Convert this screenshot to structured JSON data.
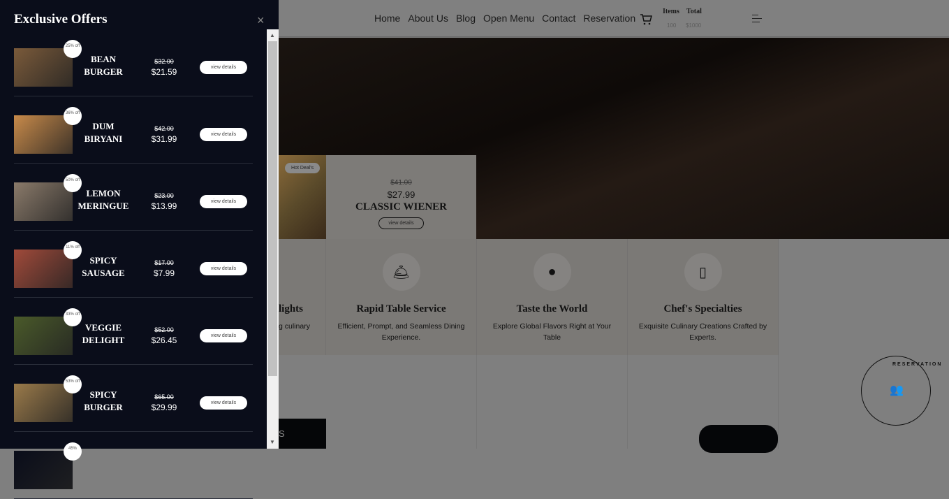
{
  "nav": {
    "items": [
      "Home",
      "About Us",
      "Blog",
      "Open Menu",
      "Contact",
      "Reservation"
    ]
  },
  "cart": {
    "items_label": "Items",
    "total_label": "Total",
    "items_value": "100",
    "total_value": "$1000"
  },
  "hero_deal": {
    "badge": "Hot Deal's",
    "old_price": "$41.00",
    "price": "$27.99",
    "name": "CLASSIC WIENER",
    "button": "view details"
  },
  "features": [
    {
      "title": "lights",
      "desc": "g culinary"
    },
    {
      "title": "Rapid Table Service",
      "desc": "Efficient, Prompt, and Seamless Dining Experience."
    },
    {
      "title": "Taste the World",
      "desc": "Explore Global Flavors Right at Your Table"
    },
    {
      "title": "Chef's Specialties",
      "desc": "Exquisite Culinary Creations Crafted by Experts."
    }
  ],
  "bottom_button_fragment": "S",
  "stamp": {
    "text": "RESERVATION"
  },
  "panel": {
    "title": "Exclusive Offers",
    "close": "×",
    "items": [
      {
        "name": "BEAN BURGER",
        "badge": "25% off",
        "old": "$32.00",
        "price": "$21.59",
        "button": "view details",
        "color": "#7a5a3a"
      },
      {
        "name": "DUM BIRYANI",
        "badge": "36% off",
        "old": "$42.00",
        "price": "$31.99",
        "button": "view details",
        "color": "#c88a4a"
      },
      {
        "name": "LEMON MERINGUE",
        "badge": "50% off",
        "old": "$23.00",
        "price": "$13.99",
        "button": "view details",
        "color": "#8a7a6a"
      },
      {
        "name": "SPICY SAUSAGE",
        "badge": "11% off",
        "old": "$17.00",
        "price": "$7.99",
        "button": "view details",
        "color": "#a04a3a"
      },
      {
        "name": "VEGGIE DELIGHT",
        "badge": "33% off",
        "old": "$52.00",
        "price": "$26.45",
        "button": "view details",
        "color": "#4a5a2a"
      },
      {
        "name": "SPICY BURGER",
        "badge": "53% off",
        "old": "$65.00",
        "price": "$29.99",
        "button": "view details",
        "color": "#9a7a4a"
      },
      {
        "name": "",
        "badge": "45%",
        "old": "",
        "price": "",
        "button": "",
        "color": "#0a0d1a"
      }
    ]
  }
}
